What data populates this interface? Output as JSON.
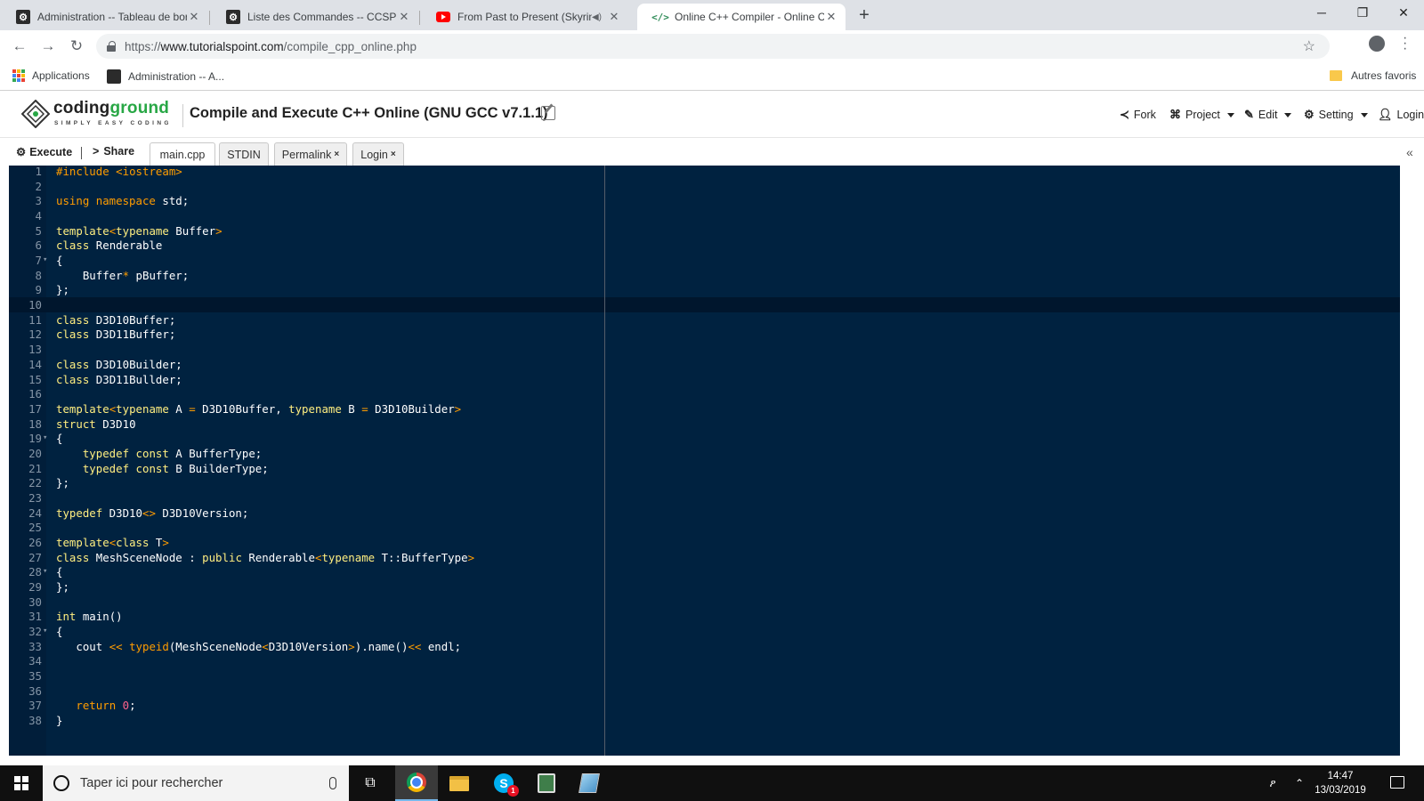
{
  "browser": {
    "tabs": [
      {
        "title": "Administration -- Tableau de bord",
        "favicon": "tb"
      },
      {
        "title": "Liste des Commandes -- CCSP Carrosserie",
        "favicon": "tb"
      },
      {
        "title": "From Past to Present (Skyrim)",
        "favicon": "yt"
      },
      {
        "title": "Online C++ Compiler - Online C++",
        "favicon": "code"
      }
    ],
    "new_tab": "+",
    "window_controls": {
      "minimize": "─",
      "restore": "❐",
      "close": "✕"
    },
    "url_scheme": "https://",
    "url_host": "www.tutorialspoint.com",
    "url_path": "/compile_cpp_online.php",
    "bookmarks": {
      "apps": "Applications",
      "admin": "Administration -- A...",
      "others": "Autres favoris"
    }
  },
  "site": {
    "logo_main": "coding",
    "logo_accent": "ground",
    "logo_tagline": "SIMPLY EASY CODING",
    "page_title": "Compile and Execute C++ Online (GNU GCC v7.1.1)",
    "nav": {
      "fork": "Fork",
      "project": "Project",
      "edit": "Edit",
      "setting": "Setting",
      "login": "Login"
    }
  },
  "editor_toolbar": {
    "execute": "Execute",
    "share": "Share",
    "tabs": [
      "main.cpp",
      "STDIN",
      "Permalink",
      "Login"
    ]
  },
  "editor": {
    "active_line": 10,
    "lines": [
      {
        "n": "1",
        "fold": "",
        "html": "<span class=\"pp\">#include</span> <span class=\"p\">&lt;iostream&gt;</span>"
      },
      {
        "n": "2",
        "fold": "",
        "html": ""
      },
      {
        "n": "3",
        "fold": "",
        "html": "<span class=\"k\">using namespace</span> std;"
      },
      {
        "n": "4",
        "fold": "",
        "html": ""
      },
      {
        "n": "5",
        "fold": "",
        "html": "<span class=\"t\">template</span><span class=\"p\">&lt;</span><span class=\"t\">typename</span> Buffer<span class=\"p\">&gt;</span>"
      },
      {
        "n": "6",
        "fold": "",
        "html": "<span class=\"t\">class</span> Renderable"
      },
      {
        "n": "7",
        "fold": "▾",
        "html": "{"
      },
      {
        "n": "8",
        "fold": "",
        "html": "    Buffer<span class=\"p\">*</span> pBuffer;"
      },
      {
        "n": "9",
        "fold": "",
        "html": "};"
      },
      {
        "n": "10",
        "fold": "",
        "html": ""
      },
      {
        "n": "11",
        "fold": "",
        "html": "<span class=\"t\">class</span> D3D10Buffer;"
      },
      {
        "n": "12",
        "fold": "",
        "html": "<span class=\"t\">class</span> D3D11Buffer;"
      },
      {
        "n": "13",
        "fold": "",
        "html": ""
      },
      {
        "n": "14",
        "fold": "",
        "html": "<span class=\"t\">class</span> D3D10Builder;"
      },
      {
        "n": "15",
        "fold": "",
        "html": "<span class=\"t\">class</span> D3D11Bullder;"
      },
      {
        "n": "16",
        "fold": "",
        "html": ""
      },
      {
        "n": "17",
        "fold": "",
        "html": "<span class=\"t\">template</span><span class=\"p\">&lt;</span><span class=\"t\">typename</span> A <span class=\"p\">=</span> D3D10Buffer, <span class=\"t\">typename</span> B <span class=\"p\">=</span> D3D10Builder<span class=\"p\">&gt;</span>"
      },
      {
        "n": "18",
        "fold": "",
        "html": "<span class=\"t\">struct</span> D3D10"
      },
      {
        "n": "19",
        "fold": "▾",
        "html": "{"
      },
      {
        "n": "20",
        "fold": "",
        "html": "    <span class=\"t\">typedef const</span> A BufferType;"
      },
      {
        "n": "21",
        "fold": "",
        "html": "    <span class=\"t\">typedef const</span> B BuilderType;"
      },
      {
        "n": "22",
        "fold": "",
        "html": "};"
      },
      {
        "n": "23",
        "fold": "",
        "html": ""
      },
      {
        "n": "24",
        "fold": "",
        "html": "<span class=\"t\">typedef</span> D3D10<span class=\"p\">&lt;&gt;</span> D3D10Version;"
      },
      {
        "n": "25",
        "fold": "",
        "html": ""
      },
      {
        "n": "26",
        "fold": "",
        "html": "<span class=\"t\">template</span><span class=\"p\">&lt;</span><span class=\"t\">class</span> T<span class=\"p\">&gt;</span>"
      },
      {
        "n": "27",
        "fold": "",
        "html": "<span class=\"t\">class</span> MeshSceneNode : <span class=\"t\">public</span> Renderable<span class=\"p\">&lt;</span><span class=\"t\">typename</span> T::BufferType<span class=\"p\">&gt;</span>"
      },
      {
        "n": "28",
        "fold": "▾",
        "html": "{"
      },
      {
        "n": "29",
        "fold": "",
        "html": "};"
      },
      {
        "n": "30",
        "fold": "",
        "html": ""
      },
      {
        "n": "31",
        "fold": "",
        "html": "<span class=\"t\">int</span> main()"
      },
      {
        "n": "32",
        "fold": "▾",
        "html": "{"
      },
      {
        "n": "33",
        "fold": "",
        "html": "   cout <span class=\"p\">&lt;&lt;</span> <span class=\"k\">typeid</span>(MeshSceneNode<span class=\"p\">&lt;</span>D3D10Version<span class=\"p\">&gt;</span>).name()<span class=\"p\">&lt;&lt;</span> endl;"
      },
      {
        "n": "34",
        "fold": "",
        "html": ""
      },
      {
        "n": "35",
        "fold": "",
        "html": ""
      },
      {
        "n": "36",
        "fold": "",
        "html": ""
      },
      {
        "n": "37",
        "fold": "",
        "html": "   <span class=\"k\">return</span> <span class=\"n\">0</span>;"
      },
      {
        "n": "38",
        "fold": "",
        "html": "}"
      }
    ]
  },
  "taskbar": {
    "search_placeholder": "Taper ici pour rechercher",
    "skype_badge": "1",
    "time": "14:47",
    "date": "13/03/2019"
  },
  "colors": {
    "editor_bg": "#002240",
    "keyword": "#ffee80",
    "operator": "#ff9d00",
    "number": "#ff628c",
    "brand_green": "#28a745"
  },
  "icons": {
    "back": "arrow-left-icon",
    "forward": "arrow-right-icon",
    "reload": "reload-icon",
    "bookmark": "star-icon",
    "execute": "gear-icon",
    "share": "share-icon",
    "fork": "fork-icon",
    "project": "sitemap-icon",
    "edit": "edit-icon",
    "setting": "gear-icon",
    "login": "user-icon"
  }
}
